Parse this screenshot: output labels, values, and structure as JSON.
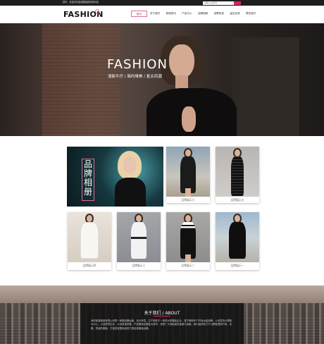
{
  "topbar": {
    "welcome": "您好，欢迎访问品质服装网站演示站",
    "search_placeholder": "请输入关键词"
  },
  "header": {
    "logo": "FASHION",
    "nav": [
      "首页",
      "关于我们",
      "新闻资讯",
      "产品中心",
      "品牌相册",
      "招聘信息",
      "留言反馈",
      "联系我们"
    ]
  },
  "banner": {
    "title": "FASHION",
    "subtitle": "清新牛仔 / 简约唯美 / 复古风潮"
  },
  "gallery": {
    "feature_title": "品牌相册",
    "cards": [
      {
        "caption": "品牌展示六"
      },
      {
        "caption": "品牌展示五"
      },
      {
        "caption": "品牌展示四"
      },
      {
        "caption": "品牌展示三"
      },
      {
        "caption": "品牌展示二"
      },
      {
        "caption": "品牌展示一"
      }
    ]
  },
  "about": {
    "title": "关于我们 / ABOUT",
    "text": "深圳某某服装有限公司是一家集品牌运营、设计研发、生产销售于一体的大型服装企业，旗下拥有多个时尚女装品牌。公司坚持以顾客为中心，以品质求生存，以创新谋发展，产品畅销全国各大城市，深受广大消费者的喜爱与信赖。我们始终致力于为顾客提供时尚、优雅、舒适的服装，打造具有国际影响力的民族服装品牌。"
  },
  "colors": {
    "accent": "#d6226a",
    "accent_light": "#e06d9e",
    "topbar": "#1e1e1e"
  }
}
